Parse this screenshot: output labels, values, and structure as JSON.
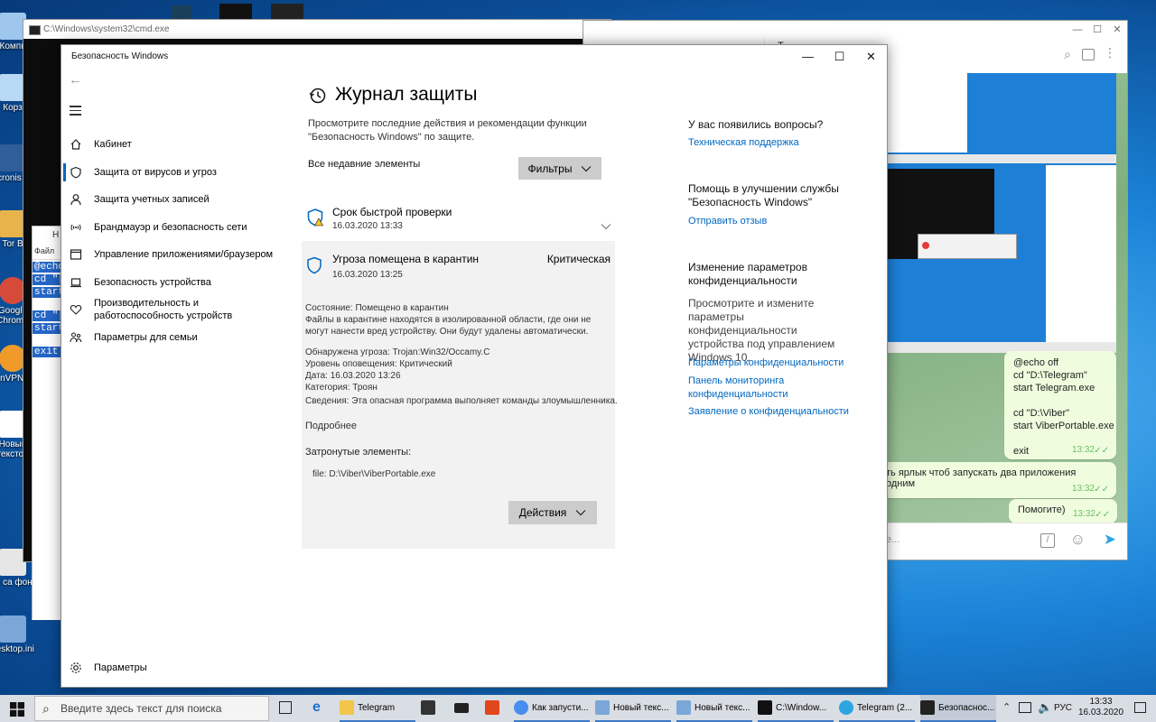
{
  "desktop": {
    "icons": [
      "Компь",
      "Корз",
      "Acronis Im",
      "Tor B",
      "Google Chrome",
      "OpenVPN GUI",
      "Новый текстов",
      "Для са фон.vi",
      "desktop.ini"
    ]
  },
  "cmd": {
    "title": "C:\\Windows\\system32\\cmd.exe"
  },
  "notepad": {
    "title": "Н",
    "menu": "Файл",
    "lines": [
      "@echo",
      "cd \"[",
      "start",
      "cd \"[",
      "start",
      "exit"
    ]
  },
  "telegram": {
    "header_title": "Т",
    "messages": [
      {
        "text_lines": [
          "@echo off",
          "cd \"D:\\Telegram\"",
          "start Telegram.exe",
          "",
          "cd \"D:\\Viber\"",
          "start ViberPortable.exe",
          "",
          "exit"
        ],
        "time": "13:32"
      },
      {
        "text": "ть ярлык чтоб запускать два приложения одним",
        "time": "13:32"
      },
      {
        "text": "Помогите)",
        "time": "13:32"
      }
    ],
    "input_placeholder": "е..."
  },
  "security": {
    "window_title": "Безопасность Windows",
    "nav": [
      {
        "label": "Кабинет",
        "icon": "home-icon"
      },
      {
        "label": "Защита от вирусов и угроз",
        "icon": "shield-icon",
        "selected": true
      },
      {
        "label": "Защита учетных записей",
        "icon": "person-icon"
      },
      {
        "label": "Брандмауэр и безопасность сети",
        "icon": "wifi-icon"
      },
      {
        "label": "Управление приложениями/браузером",
        "icon": "app-window-icon"
      },
      {
        "label": "Безопасность устройства",
        "icon": "laptop-icon"
      },
      {
        "label": "Производительность и работоспособность устройств",
        "icon": "heart-icon"
      },
      {
        "label": "Параметры для семьи",
        "icon": "family-icon"
      }
    ],
    "settings_label": "Параметры",
    "page_title": "Журнал защиты",
    "page_desc": "Просмотрите последние действия и рекомендации функции \"Безопасность Windows\" по защите.",
    "all_recent": "Все недавние элементы",
    "filters": "Фильтры",
    "item1": {
      "title": "Срок быстрой проверки",
      "date": "16.03.2020 13:33"
    },
    "item2": {
      "title": "Угроза помещена в карантин",
      "severity": "Критическая",
      "date": "16.03.2020 13:25",
      "state": "Состояние: Помещено в карантин",
      "state_desc": "Файлы в карантине находятся в изолированной области, где они не могут нанести вред устройству. Они будут удалены автоматически.",
      "threat": "Обнаружена угроза:  Trojan:Win32/Occamy.C",
      "alert_level": "Уровень оповещения:  Критический",
      "date_line": "Дата:  16.03.2020 13:26",
      "category": "Категория:  Троян",
      "details": "Сведения:  Эта опасная программа выполняет команды злоумышленника.",
      "more": "Подробнее",
      "affected_title": "Затронутые элементы:",
      "affected_file": "file: D:\\Viber\\ViberPortable.exe",
      "actions": "Действия"
    },
    "side": {
      "q_title": "У вас появились вопросы?",
      "q_link": "Техническая поддержка",
      "improve_title": "Помощь в улучшении службы \"Безопасность Windows\"",
      "improve_link": "Отправить отзыв",
      "privacy_title": "Изменение параметров конфиденциальности",
      "privacy_desc": "Просмотрите и измените параметры конфиденциальности устройства под управлением Windows 10.",
      "privacy_link1": "Параметры конфиденциальности",
      "privacy_link2": "Панель мониторинга конфиденциальности",
      "privacy_link3": "Заявление о конфиденциальности"
    }
  },
  "taskbar": {
    "search_placeholder": "Введите здесь текст для поиска",
    "items": [
      {
        "label": "Telegram",
        "icon": "folder-icon",
        "color": "#f3c54a"
      },
      {
        "label": "",
        "icon": "store-icon",
        "color": "#333333"
      },
      {
        "label": "",
        "icon": "mail-icon",
        "color": "#222222"
      },
      {
        "label": "",
        "icon": "office-icon",
        "color": "#e2461c"
      },
      {
        "label": "Как запусти...",
        "icon": "chrome-icon",
        "color": "#4a8df0"
      },
      {
        "label": "Новый текс...",
        "icon": "notepad-icon",
        "color": "#7aa7d8"
      },
      {
        "label": "Новый текс...",
        "icon": "notepad-icon",
        "color": "#7aa7d8"
      },
      {
        "label": "C:\\Window...",
        "icon": "cmd-icon",
        "color": "#111111"
      },
      {
        "label": "Telegram (2...",
        "icon": "telegram-icon",
        "color": "#2ca5e0"
      },
      {
        "label": "Безопаснос...",
        "icon": "defender-icon",
        "color": "#222222"
      }
    ],
    "lang": "РУС",
    "time": "13:33",
    "date": "16.03.2020"
  }
}
